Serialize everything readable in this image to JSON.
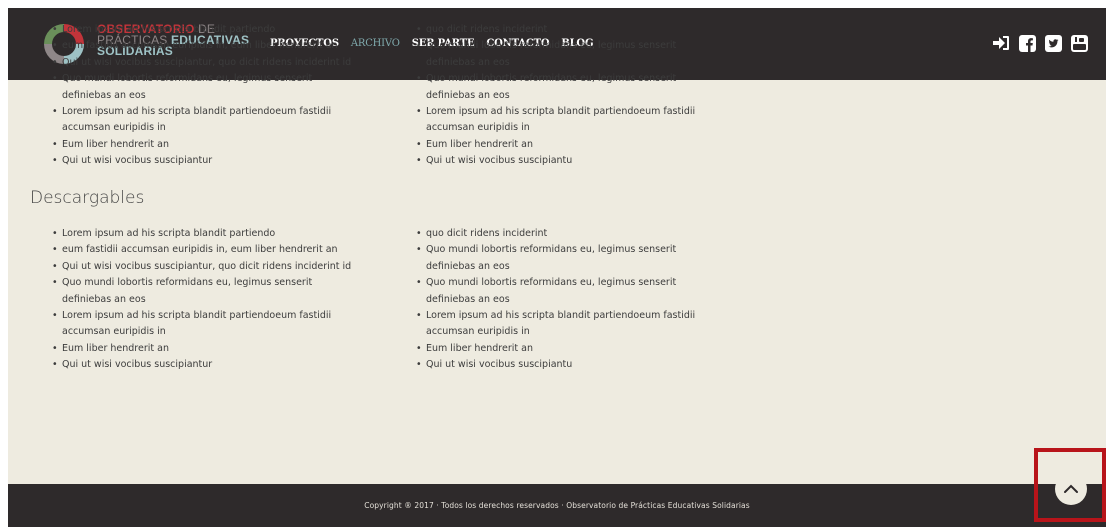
{
  "header": {
    "logo_line1_a": "OBSERVATORIO",
    "logo_line1_b": " DE",
    "logo_line2_a": "PRÁCTICAS ",
    "logo_line2_b": "EDUCATIVAS",
    "logo_line3": "SOLIDARIAS",
    "nav": [
      {
        "label": "PROYECTOS",
        "active": false
      },
      {
        "label": "ARCHIVO",
        "active": true
      },
      {
        "label": "SER PARTE",
        "active": false
      },
      {
        "label": "CONTACTO",
        "active": false
      },
      {
        "label": "BLOG",
        "active": false
      }
    ],
    "social": [
      "login-icon",
      "facebook-icon",
      "twitter-icon",
      "youtube-icon"
    ]
  },
  "block1": {
    "left": [
      "Lorem ipsum ad his scripta blandit partiendo",
      "eum fastidii accumsan euripidis in, eum liber hendrerit an",
      "Qui ut wisi vocibus suscipiantur, quo dicit ridens inciderint id",
      "Quo mundi lobortis reformidans eu, legimus senserit definiebas an eos",
      "Lorem ipsum ad his scripta blandit partiendoeum fastidii accumsan euripidis in",
      "Eum liber hendrerit an",
      "Qui ut wisi vocibus suscipiantur"
    ],
    "right": [
      "quo dicit ridens inciderint",
      "Quo mundi lobortis reformidans eu, legimus senserit definiebas an eos",
      "Quo mundi lobortis reformidans eu, legimus senserit definiebas an eos",
      "Lorem ipsum ad his scripta blandit partiendoeum fastidii accumsan euripidis in",
      "Eum liber hendrerit an",
      "Qui ut wisi vocibus suscipiantu"
    ]
  },
  "section_title": "Descargables",
  "block2": {
    "left": [
      "Lorem ipsum ad his scripta blandit partiendo",
      "eum fastidii accumsan euripidis in, eum liber hendrerit an",
      "Qui ut wisi vocibus suscipiantur, quo dicit ridens inciderint id",
      "Quo mundi lobortis reformidans eu, legimus senserit definiebas an eos",
      "Lorem ipsum ad his scripta blandit partiendoeum fastidii accumsan euripidis in",
      "Eum liber hendrerit an",
      "Qui ut wisi vocibus suscipiantur"
    ],
    "right": [
      "quo dicit ridens inciderint",
      "Quo mundi lobortis reformidans eu, legimus senserit definiebas an eos",
      "Quo mundi lobortis reformidans eu, legimus senserit definiebas an eos",
      "Lorem ipsum ad his scripta blandit partiendoeum fastidii accumsan euripidis in",
      "Eum liber hendrerit an",
      "Qui ut wisi vocibus suscipiantu"
    ]
  },
  "footer": {
    "copyright": "Copyright ® 2017 · Todos los derechos reservados · Observatorio de Prácticas Educativas Solidarias"
  },
  "scroll_top_icon": "chevron-up-icon",
  "colors": {
    "header_bg": "#2e2a2b",
    "content_bg": "#eeebe0",
    "logo_red": "#c2343a",
    "logo_teal": "#9ec2c5",
    "nav_active": "#7fa9ac",
    "highlight": "#b8141a"
  }
}
